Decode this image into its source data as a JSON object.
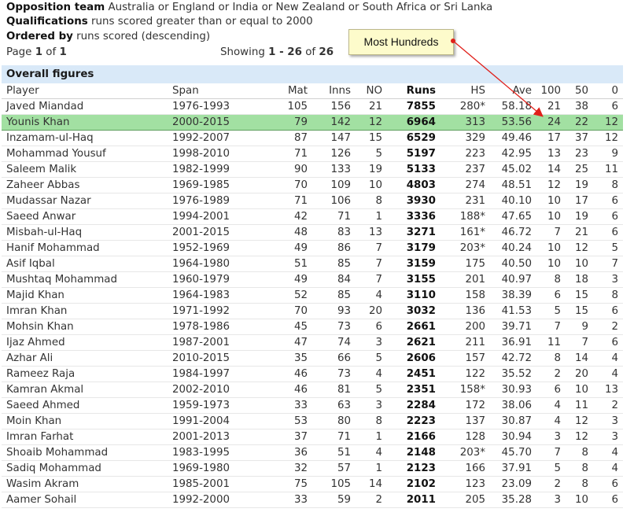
{
  "filters": {
    "opposition_label": "Opposition team",
    "opposition_value": "Australia or England or India or New Zealand or South Africa or Sri Lanka",
    "qualifications_label": "Qualifications",
    "qualifications_value": "runs scored greater than or equal to 2000",
    "ordered_label": "Ordered by",
    "ordered_value": "runs scored (descending)"
  },
  "paging": {
    "page_prefix": "Page",
    "page_num": "1",
    "page_of": "of",
    "page_total": "1",
    "showing_prefix": "Showing",
    "showing_range": "1 - 26",
    "showing_of": "of",
    "showing_total": "26"
  },
  "section_title": "Overall figures",
  "callout": {
    "label": "Most Hundreds"
  },
  "colors": {
    "highlight": "#a2e0a2",
    "section_bg": "#d9e9f8",
    "callout_bg": "#fdfbcb",
    "arrow": "#e0201a"
  },
  "table": {
    "headers": [
      "Player",
      "Span",
      "Mat",
      "Inns",
      "NO",
      "Runs",
      "HS",
      "Ave",
      "100",
      "50",
      "0"
    ],
    "highlighted_row": 1,
    "rows": [
      [
        "Javed Miandad",
        "1976-1993",
        "105",
        "156",
        "21",
        "7855",
        "280*",
        "58.18",
        "21",
        "38",
        "6"
      ],
      [
        "Younis Khan",
        "2000-2015",
        "79",
        "142",
        "12",
        "6964",
        "313",
        "53.56",
        "24",
        "22",
        "12"
      ],
      [
        "Inzamam-ul-Haq",
        "1992-2007",
        "87",
        "147",
        "15",
        "6529",
        "329",
        "49.46",
        "17",
        "37",
        "12"
      ],
      [
        "Mohammad Yousuf",
        "1998-2010",
        "71",
        "126",
        "5",
        "5197",
        "223",
        "42.95",
        "13",
        "23",
        "9"
      ],
      [
        "Saleem Malik",
        "1982-1999",
        "90",
        "133",
        "19",
        "5133",
        "237",
        "45.02",
        "14",
        "25",
        "11"
      ],
      [
        "Zaheer Abbas",
        "1969-1985",
        "70",
        "109",
        "10",
        "4803",
        "274",
        "48.51",
        "12",
        "19",
        "8"
      ],
      [
        "Mudassar Nazar",
        "1976-1989",
        "71",
        "106",
        "8",
        "3930",
        "231",
        "40.10",
        "10",
        "17",
        "6"
      ],
      [
        "Saeed Anwar",
        "1994-2001",
        "42",
        "71",
        "1",
        "3336",
        "188*",
        "47.65",
        "10",
        "19",
        "6"
      ],
      [
        "Misbah-ul-Haq",
        "2001-2015",
        "48",
        "83",
        "13",
        "3271",
        "161*",
        "46.72",
        "7",
        "21",
        "6"
      ],
      [
        "Hanif Mohammad",
        "1952-1969",
        "49",
        "86",
        "7",
        "3179",
        "203*",
        "40.24",
        "10",
        "12",
        "5"
      ],
      [
        "Asif Iqbal",
        "1964-1980",
        "51",
        "85",
        "7",
        "3159",
        "175",
        "40.50",
        "10",
        "10",
        "7"
      ],
      [
        "Mushtaq Mohammad",
        "1960-1979",
        "49",
        "84",
        "7",
        "3155",
        "201",
        "40.97",
        "8",
        "18",
        "3"
      ],
      [
        "Majid Khan",
        "1964-1983",
        "52",
        "85",
        "4",
        "3110",
        "158",
        "38.39",
        "6",
        "15",
        "8"
      ],
      [
        "Imran Khan",
        "1971-1992",
        "70",
        "93",
        "20",
        "3032",
        "136",
        "41.53",
        "5",
        "15",
        "6"
      ],
      [
        "Mohsin Khan",
        "1978-1986",
        "45",
        "73",
        "6",
        "2661",
        "200",
        "39.71",
        "7",
        "9",
        "2"
      ],
      [
        "Ijaz Ahmed",
        "1987-2001",
        "47",
        "74",
        "3",
        "2621",
        "211",
        "36.91",
        "11",
        "7",
        "6"
      ],
      [
        "Azhar Ali",
        "2010-2015",
        "35",
        "66",
        "5",
        "2606",
        "157",
        "42.72",
        "8",
        "14",
        "4"
      ],
      [
        "Rameez Raja",
        "1984-1997",
        "46",
        "73",
        "4",
        "2451",
        "122",
        "35.52",
        "2",
        "20",
        "4"
      ],
      [
        "Kamran Akmal",
        "2002-2010",
        "46",
        "81",
        "5",
        "2351",
        "158*",
        "30.93",
        "6",
        "10",
        "13"
      ],
      [
        "Saeed Ahmed",
        "1959-1973",
        "33",
        "63",
        "3",
        "2284",
        "172",
        "38.06",
        "4",
        "11",
        "2"
      ],
      [
        "Moin Khan",
        "1991-2004",
        "53",
        "80",
        "8",
        "2223",
        "137",
        "30.87",
        "4",
        "12",
        "3"
      ],
      [
        "Imran Farhat",
        "2001-2013",
        "37",
        "71",
        "1",
        "2166",
        "128",
        "30.94",
        "3",
        "12",
        "3"
      ],
      [
        "Shoaib Mohammad",
        "1983-1995",
        "36",
        "51",
        "4",
        "2148",
        "203*",
        "45.70",
        "7",
        "8",
        "4"
      ],
      [
        "Sadiq Mohammad",
        "1969-1980",
        "32",
        "57",
        "1",
        "2123",
        "166",
        "37.91",
        "5",
        "8",
        "4"
      ],
      [
        "Wasim Akram",
        "1985-2001",
        "75",
        "105",
        "14",
        "2102",
        "123",
        "23.09",
        "2",
        "8",
        "6"
      ],
      [
        "Aamer Sohail",
        "1992-2000",
        "33",
        "59",
        "2",
        "2011",
        "205",
        "35.28",
        "3",
        "10",
        "6"
      ]
    ]
  }
}
